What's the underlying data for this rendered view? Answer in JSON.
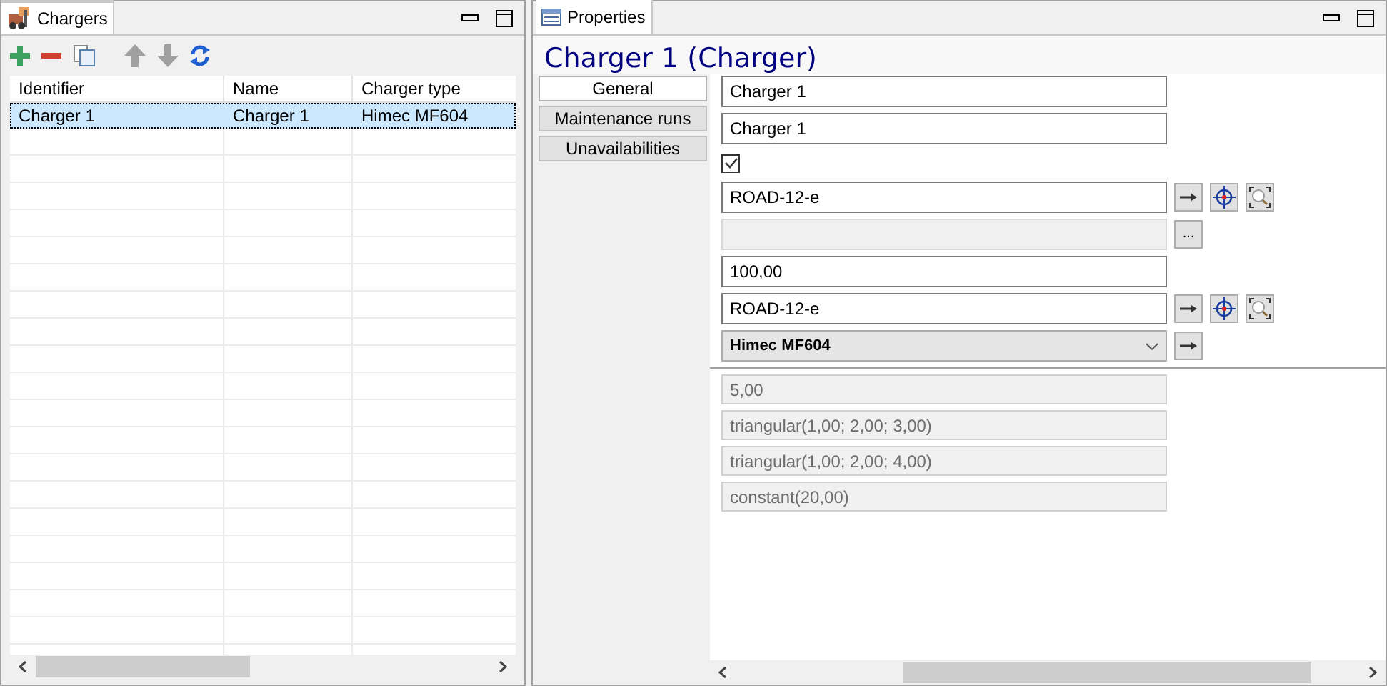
{
  "chargers_panel": {
    "tab": "Chargers",
    "table": {
      "columns": [
        "Identifier",
        "Name",
        "Charger type"
      ],
      "rows": [
        {
          "cells": [
            "Charger 1",
            "Charger 1",
            "Himec MF604"
          ],
          "selected": true
        }
      ]
    }
  },
  "properties_panel": {
    "tab": "Properties",
    "heading": "Charger 1 (Charger)",
    "sections": [
      {
        "label": "General",
        "selected": true
      },
      {
        "label": "Maintenance runs",
        "selected": false
      },
      {
        "label": "Unavailabilities",
        "selected": false
      }
    ],
    "fields": [
      {
        "kind": "text",
        "value": "Charger 1"
      },
      {
        "kind": "text",
        "value": "Charger 1"
      },
      {
        "kind": "checkbox",
        "checked": true
      },
      {
        "kind": "text",
        "value": "ROAD-12-e",
        "goto_button": true,
        "locate_button": true,
        "zoom_button": true
      },
      {
        "kind": "disabled",
        "browse_button": "..."
      },
      {
        "kind": "text",
        "value": "100,00"
      },
      {
        "kind": "text",
        "value": "ROAD-12-e",
        "goto_button": true,
        "locate_button": true,
        "zoom_button": true
      },
      {
        "kind": "select",
        "value": "Himec MF604",
        "goto_button": true
      },
      {
        "kind": "divider"
      },
      {
        "kind": "readonly",
        "value": "5,00"
      },
      {
        "kind": "readonly",
        "value": "triangular(1,00; 2,00; 3,00)"
      },
      {
        "kind": "readonly",
        "value": "triangular(1,00; 2,00; 4,00)"
      },
      {
        "kind": "readonly",
        "value": "constant(20,00)"
      }
    ]
  }
}
